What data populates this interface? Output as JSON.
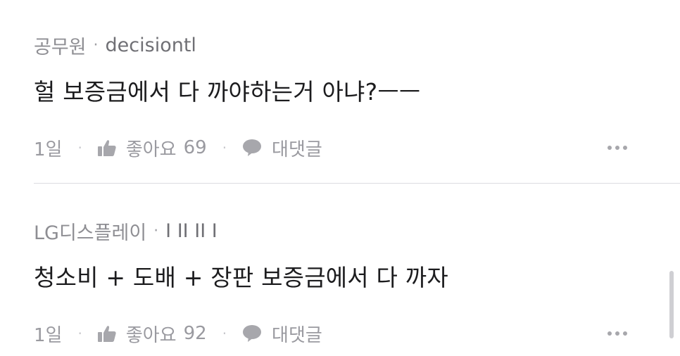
{
  "comments": [
    {
      "company": "공무원",
      "separator": "·",
      "nickname": "decisiontl",
      "text": "헐 보증금에서 다 까야하는거 아냐?ㅡㅡ",
      "time": "1일",
      "like_label": "좋아요",
      "like_count": "69",
      "reply_label": "대댓글"
    },
    {
      "company": "LG디스플레이",
      "separator": "·",
      "nickname": "I II II I",
      "text": "청소비 + 도배 + 장판  보증금에서 다 까자",
      "time": "1일",
      "like_label": "좋아요",
      "like_count": "92",
      "reply_label": "대댓글"
    }
  ],
  "action_separator": "·",
  "icons": {
    "like": "thumbs-up-icon",
    "reply": "speech-bubble-icon",
    "more": "more-dots-icon"
  },
  "colors": {
    "meta_text": "#8e8e93",
    "body_text": "#1c1c1e",
    "icon": "#9a9aa0",
    "divider": "#dcdce0"
  }
}
